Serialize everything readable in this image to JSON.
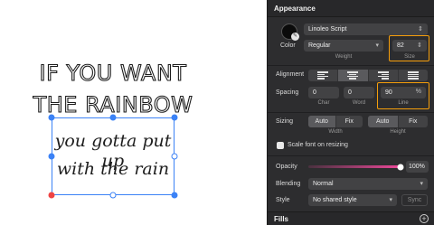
{
  "canvas": {
    "line1": "IF YOU WANT",
    "line2": "THE RAINBOW",
    "script_line1": "you gotta put up",
    "script_line2": "with the rain"
  },
  "inspector": {
    "title": "Appearance",
    "font_family": "Linoleo Script",
    "color_label": "Color",
    "weight_value": "Regular",
    "weight_label": "Weight",
    "size_value": "82",
    "size_label": "Size",
    "alignment_label": "Alignment",
    "spacing_label": "Spacing",
    "char_value": "0",
    "char_label": "Char",
    "word_value": "0",
    "word_label": "Word",
    "line_value": "90",
    "line_unit": "%",
    "line_label": "Line",
    "sizing_label": "Sizing",
    "width_auto": "Auto",
    "width_fix": "Fix",
    "width_label": "Width",
    "height_auto": "Auto",
    "height_fix": "Fix",
    "height_label": "Height",
    "scale_font_label": "Scale font on resizing",
    "opacity_label": "Opacity",
    "opacity_value": "100%",
    "opacity_level": 1.0,
    "blending_label": "Blending",
    "blending_value": "Normal",
    "style_label": "Style",
    "style_value": "No shared style",
    "sync_label": "Sync",
    "fills_label": "Fills"
  },
  "colors": {
    "accent_highlight": "#f59e0b",
    "selection": "#3b82f6",
    "opacity_slider": "#ec4899"
  }
}
